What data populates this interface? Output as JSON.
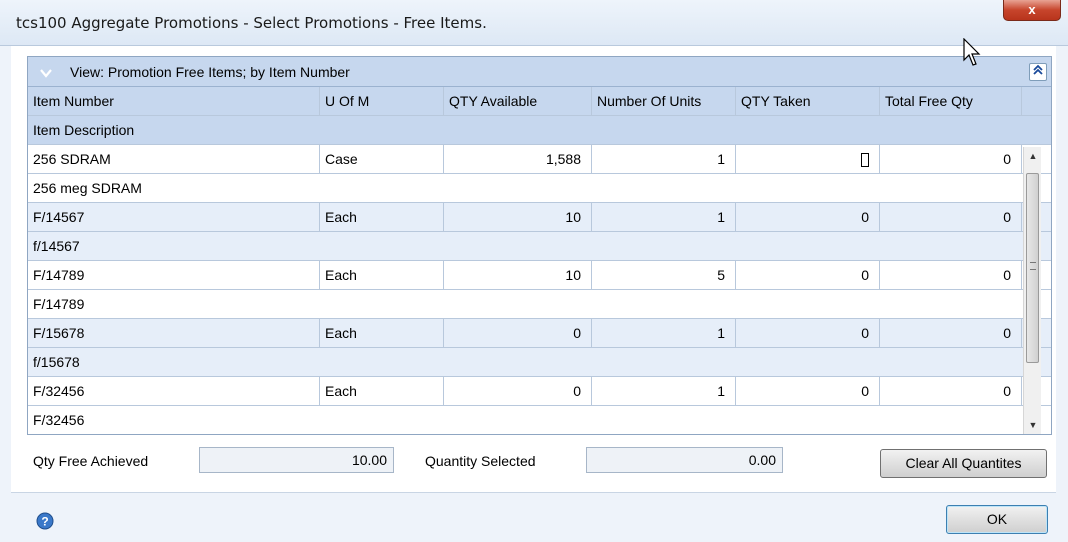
{
  "window": {
    "title": "tcs100 Aggregate Promotions - Select Promotions - Free Items.",
    "close_glyph": "x"
  },
  "view": {
    "label": "View: Promotion Free Items; by Item Number",
    "chevron_icon": "chevron-down-icon",
    "collapse_glyph": "»"
  },
  "columns": [
    "Item Number",
    "U Of M",
    "QTY Available",
    "Number Of Units",
    "QTY Taken",
    "Total Free Qty"
  ],
  "subheader": "Item Description",
  "rows": [
    {
      "item": "256 SDRAM",
      "uom": "Case",
      "available": "1,588",
      "units": "1",
      "taken": "",
      "total": "0",
      "description": "256 meg SDRAM"
    },
    {
      "item": "F/14567",
      "uom": "Each",
      "available": "10",
      "units": "1",
      "taken": "0",
      "total": "0",
      "description": "f/14567"
    },
    {
      "item": "F/14789",
      "uom": "Each",
      "available": "10",
      "units": "5",
      "taken": "0",
      "total": "0",
      "description": "F/14789"
    },
    {
      "item": "F/15678",
      "uom": "Each",
      "available": "0",
      "units": "1",
      "taken": "0",
      "total": "0",
      "description": "f/15678"
    },
    {
      "item": "F/32456",
      "uom": "Each",
      "available": "0",
      "units": "1",
      "taken": "0",
      "total": "0",
      "description": "F/32456"
    }
  ],
  "summary": {
    "qty_free_label": "Qty Free Achieved",
    "qty_free_value": "10.00",
    "qty_selected_label": "Quantity Selected",
    "qty_selected_value": "0.00",
    "clear_button": "Clear All Quantites"
  },
  "footer": {
    "ok_button": "OK"
  }
}
